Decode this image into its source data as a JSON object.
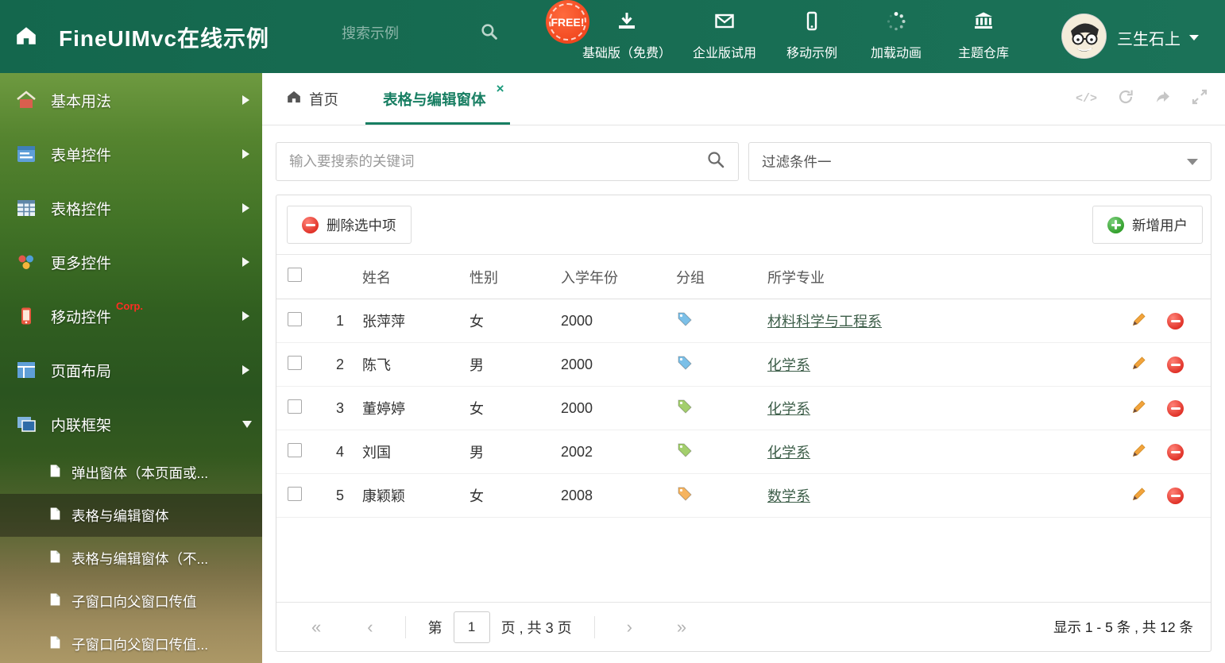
{
  "theme": {
    "header_bg": "#15694f",
    "accent": "#177e62",
    "link_color": "#3d5e49"
  },
  "header": {
    "title": "FineUIMvc在线示例",
    "search_placeholder": "搜索示例",
    "free_badge": "FREE!",
    "nav_items": [
      {
        "label": "基础版（免费）",
        "icon": "download-icon"
      },
      {
        "label": "企业版试用",
        "icon": "mail-icon"
      },
      {
        "label": "移动示例",
        "icon": "mobile-icon"
      },
      {
        "label": "加载动画",
        "icon": "spinner-icon"
      },
      {
        "label": "主题仓库",
        "icon": "bank-icon"
      }
    ],
    "user_name": "三生石上"
  },
  "sidebar": {
    "items": [
      {
        "label": "基本用法"
      },
      {
        "label": "表单控件"
      },
      {
        "label": "表格控件"
      },
      {
        "label": "更多控件"
      },
      {
        "label": "移动控件",
        "badge": "Corp."
      },
      {
        "label": "页面布局"
      },
      {
        "label": "内联框架"
      }
    ],
    "subitems": [
      {
        "label": "弹出窗体（本页面或..."
      },
      {
        "label": "表格与编辑窗体"
      },
      {
        "label": "表格与编辑窗体（不..."
      },
      {
        "label": "子窗口向父窗口传值"
      },
      {
        "label": "子窗口向父窗口传值..."
      }
    ]
  },
  "tabs": {
    "home_label": "首页",
    "active_label": "表格与编辑窗体",
    "close_glyph": "×",
    "code_glyph": "</>"
  },
  "filters": {
    "search_placeholder": "输入要搜索的关键词",
    "selected_filter": "过滤条件一"
  },
  "toolbar": {
    "delete_label": "删除选中项",
    "add_label": "新增用户"
  },
  "table": {
    "columns": [
      "姓名",
      "性别",
      "入学年份",
      "分组",
      "所学专业"
    ],
    "rows": [
      {
        "index": "1",
        "name": "张萍萍",
        "gender": "女",
        "year": "2000",
        "tag_color": "#7cc0e8",
        "major": "材料科学与工程系"
      },
      {
        "index": "2",
        "name": "陈飞",
        "gender": "男",
        "year": "2000",
        "tag_color": "#7cc0e8",
        "major": "化学系"
      },
      {
        "index": "3",
        "name": "董婷婷",
        "gender": "女",
        "year": "2000",
        "tag_color": "#a3cf6d",
        "major": "化学系"
      },
      {
        "index": "4",
        "name": "刘国",
        "gender": "男",
        "year": "2002",
        "tag_color": "#a3cf6d",
        "major": "化学系"
      },
      {
        "index": "5",
        "name": "康颖颖",
        "gender": "女",
        "year": "2008",
        "tag_color": "#f6b45f",
        "major": "数学系"
      }
    ]
  },
  "pagination": {
    "prefix": "第",
    "current_page": "1",
    "suffix": "页 , 共 3 页",
    "summary": "显示 1 - 5 条 , 共 12 条"
  }
}
